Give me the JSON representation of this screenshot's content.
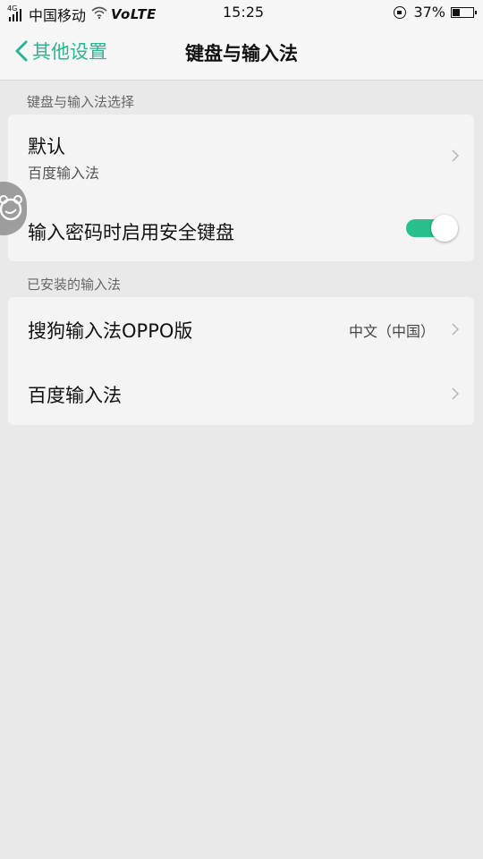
{
  "status_bar": {
    "network_tag": "4G",
    "carrier": "中国移动",
    "volte": "VoLTE",
    "time": "15:25",
    "battery_percent": "37%",
    "battery_level": 0.37
  },
  "nav": {
    "back_label": "其他设置",
    "title": "键盘与输入法"
  },
  "section_select": {
    "header": "键盘与输入法选择",
    "default_row": {
      "title": "默认",
      "subtitle": "百度输入法"
    },
    "secure_keyboard_row": {
      "title": "输入密码时启用安全键盘",
      "toggle_on": true
    }
  },
  "section_installed": {
    "header": "已安装的输入法",
    "items": [
      {
        "title": "搜狗输入法OPPO版",
        "value": "中文（中国）"
      },
      {
        "title": "百度输入法",
        "value": ""
      }
    ]
  },
  "colors": {
    "accent": "#2bb48f",
    "toggle_on": "#28c08d",
    "background": "#e9e9e9",
    "card": "#f4f4f4"
  },
  "icons": {
    "back": "chevron-left-icon",
    "row_arrow": "chevron-right-icon",
    "float_ball": "assistive-ball-icon"
  }
}
